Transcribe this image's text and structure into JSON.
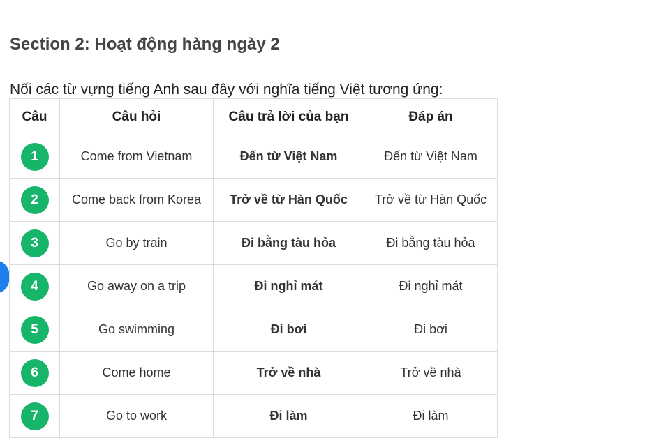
{
  "section": {
    "title": "Section 2: Hoạt động hàng ngày 2"
  },
  "instructions": "Nối các từ vựng tiếng Anh sau đây với nghĩa tiếng Việt tương ứng:",
  "table": {
    "headers": [
      "Câu",
      "Câu hỏi",
      "Câu trả lời của bạn",
      "Đáp án"
    ],
    "rows": [
      {
        "num": "1",
        "question": "Come from Vietnam",
        "user_answer": "Đến từ Việt Nam",
        "correct": "Đến từ Việt Nam"
      },
      {
        "num": "2",
        "question": "Come back from Korea",
        "user_answer": "Trở về từ Hàn Quốc",
        "correct": "Trở về từ Hàn Quốc"
      },
      {
        "num": "3",
        "question": "Go by train",
        "user_answer": "Đi bằng tàu hỏa",
        "correct": "Đi bằng tàu hỏa"
      },
      {
        "num": "4",
        "question": "Go away on a trip",
        "user_answer": "Đi nghỉ mát",
        "correct": "Đi nghỉ mát"
      },
      {
        "num": "5",
        "question": "Go swimming",
        "user_answer": "Đi bơi",
        "correct": "Đi bơi"
      },
      {
        "num": "6",
        "question": "Come home",
        "user_answer": "Trở về nhà",
        "correct": "Trở về nhà"
      },
      {
        "num": "7",
        "question": "Go to work",
        "user_answer": "Đi làm",
        "correct": "Đi làm"
      }
    ]
  },
  "colors": {
    "badge": "#16b56a",
    "user_answer": "#47c083",
    "side_button": "#1e7ff0"
  }
}
